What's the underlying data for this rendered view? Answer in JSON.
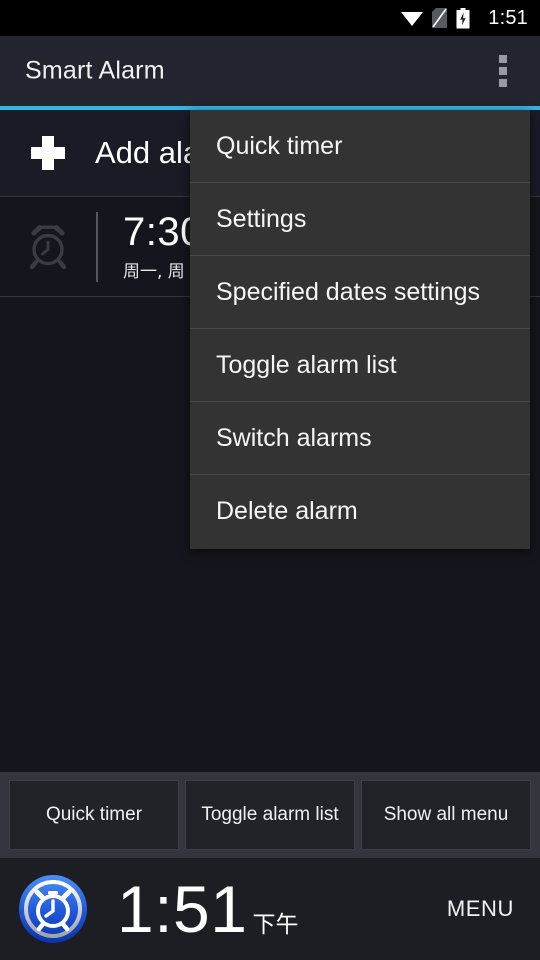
{
  "status_bar": {
    "time": "1:51",
    "icons": [
      "wifi-icon",
      "no-sim-icon",
      "battery-charging-icon"
    ]
  },
  "app_bar": {
    "title": "Smart Alarm",
    "overflow_icon": "overflow-menu-icon",
    "accent_color": "#33b5e5",
    "background_color": "#22242f"
  },
  "add_alarm": {
    "label": "Add alarm",
    "icon": "plus-icon"
  },
  "alarm_list": {
    "items": [
      {
        "icon": "alarm-clock-icon",
        "time": "7:30",
        "days": "周一, 周",
        "enabled": false
      }
    ]
  },
  "overflow_menu": {
    "background_color": "#333333",
    "items": [
      {
        "label": "Quick timer"
      },
      {
        "label": "Settings"
      },
      {
        "label": "Specified dates settings"
      },
      {
        "label": "Toggle alarm list"
      },
      {
        "label": "Switch alarms"
      },
      {
        "label": "Delete alarm"
      }
    ]
  },
  "button_bar": {
    "buttons": [
      {
        "label": "Quick timer"
      },
      {
        "label": "Toggle alarm list"
      },
      {
        "label": "Show all menu"
      }
    ]
  },
  "clock_bar": {
    "logo_icon": "blue-alarm-clock-icon",
    "time": "1:51",
    "ampm": "下午",
    "menu_label": "MENU"
  }
}
